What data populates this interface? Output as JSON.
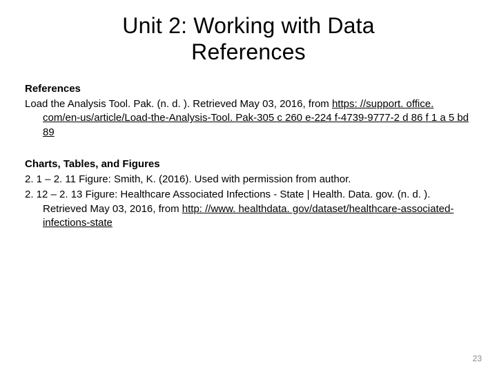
{
  "title_line1": "Unit 2: Working with Data",
  "title_line2": "References",
  "ref_heading": "References",
  "ref_prefix": "Load the Analysis Tool. Pak. (n. d. ). Retrieved May 03, 2016, from ",
  "ref_link": "https: //support. office. com/en-us/article/Load-the-Analysis-Tool. Pak-305 c 260 e-224 f-4739-9777-2 d 86 f 1 a 5 bd 89",
  "ctf_heading": "Charts, Tables, and Figures",
  "ctf_line1": "2. 1 – 2. 11 Figure: Smith, K. (2016). Used with permission from author.",
  "ctf_line2_prefix": "2. 12 – 2. 13 Figure: Healthcare Associated Infections - State | Health. Data. gov. (n. d. ). Retrieved May 03, 2016, from ",
  "ctf_line2_link": "http: //www. healthdata. gov/dataset/healthcare-associated-infections-state",
  "page_number": "23"
}
